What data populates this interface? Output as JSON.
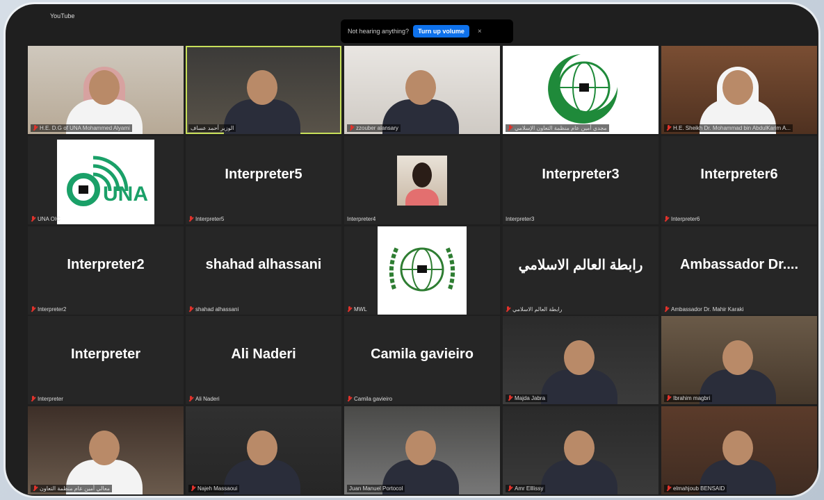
{
  "top": {
    "source_label": "YouTube",
    "notice": {
      "message": "Not hearing anything?",
      "button": "Turn up volume",
      "close": "×"
    }
  },
  "tiles": [
    {
      "name": "H.E. D.G of UNA Mohammed Alyami",
      "muted": true
    },
    {
      "name": "الوزير أحمد عساف",
      "muted": false,
      "active": true
    },
    {
      "name": "zzouber alansary",
      "muted": true
    },
    {
      "name": "مجدي أمين عام منظمة التعاون الإسلامي",
      "muted": true
    },
    {
      "name": "H.E. Sheikh Dr. Mohammad bin AbdulKarim A...",
      "muted": true
    },
    {
      "name": "UNA OIC",
      "muted": true,
      "logo": "UNA"
    },
    {
      "name": "Interpreter5",
      "muted": true,
      "big": "Interpreter5"
    },
    {
      "name": "Interpreter4",
      "muted": false
    },
    {
      "name": "Interpreter3",
      "muted": false,
      "big": "Interpreter3"
    },
    {
      "name": "Interpreter6",
      "muted": true,
      "big": "Interpreter6"
    },
    {
      "name": "Interpreter2",
      "muted": true,
      "big": "Interpreter2"
    },
    {
      "name": "shahad alhassani",
      "muted": true,
      "big": "shahad alhassani"
    },
    {
      "name": "MWL",
      "muted": true
    },
    {
      "name": "رابطة العالم الاسلامي",
      "muted": true,
      "big": "رابطة العالم الاسلامي"
    },
    {
      "name": "Ambassador Dr. Mahir Karaki",
      "muted": true,
      "big": "Ambassador  Dr...."
    },
    {
      "name": "Interpreter",
      "muted": true,
      "big": "Interpreter"
    },
    {
      "name": "Ali Naderi",
      "muted": true,
      "big": "Ali Naderi"
    },
    {
      "name": "Camila gavieiro",
      "muted": true,
      "big": "Camila gavieiro"
    },
    {
      "name": "Majda Jabra",
      "muted": true
    },
    {
      "name": "Ibrahim magbri",
      "muted": true
    },
    {
      "name": "معالي أمين عام منظمة التعاون",
      "muted": true
    },
    {
      "name": "Najeh Massaoui",
      "muted": true
    },
    {
      "name": "Juan Manuel Portocol",
      "muted": false
    },
    {
      "name": "Amr Elllissy",
      "muted": true
    },
    {
      "name": "elmahjoub BENSAID",
      "muted": true
    }
  ],
  "icons": {
    "mic_muted": "mic-muted-icon"
  },
  "colors": {
    "active_border": "#c8e05a",
    "volume_button": "#0e71eb",
    "mute": "#e0322b"
  }
}
